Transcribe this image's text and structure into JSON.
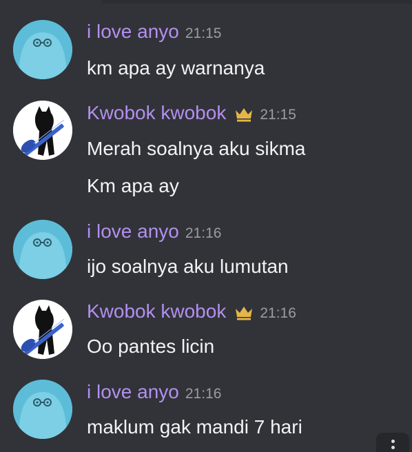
{
  "users": {
    "anyo": {
      "name": "i love anyo",
      "color": "#b48ff0"
    },
    "kwobok": {
      "name": "Kwobok kwobok",
      "color": "#b48ff0",
      "badge_icon": "crown-icon"
    }
  },
  "messages": [
    {
      "author": "i love anyo",
      "time": "21:15",
      "lines": [
        "km apa ay warnanya"
      ]
    },
    {
      "author": "Kwobok kwobok",
      "time": "21:15",
      "lines": [
        "Merah soalnya aku sikma",
        "Km apa ay"
      ]
    },
    {
      "author": "i love anyo",
      "time": "21:16",
      "lines": [
        "ijo soalnya aku lumutan"
      ]
    },
    {
      "author": "Kwobok kwobok",
      "time": "21:16",
      "lines": [
        "Oo pantes licin"
      ]
    },
    {
      "author": "i love anyo",
      "time": "21:16",
      "lines": [
        "maklum gak mandi 7 hari"
      ]
    }
  ],
  "colors": {
    "background": "#313338",
    "text": "#f2f3f5",
    "timestamp": "#9a9ca3",
    "crown": "#e5b647"
  }
}
